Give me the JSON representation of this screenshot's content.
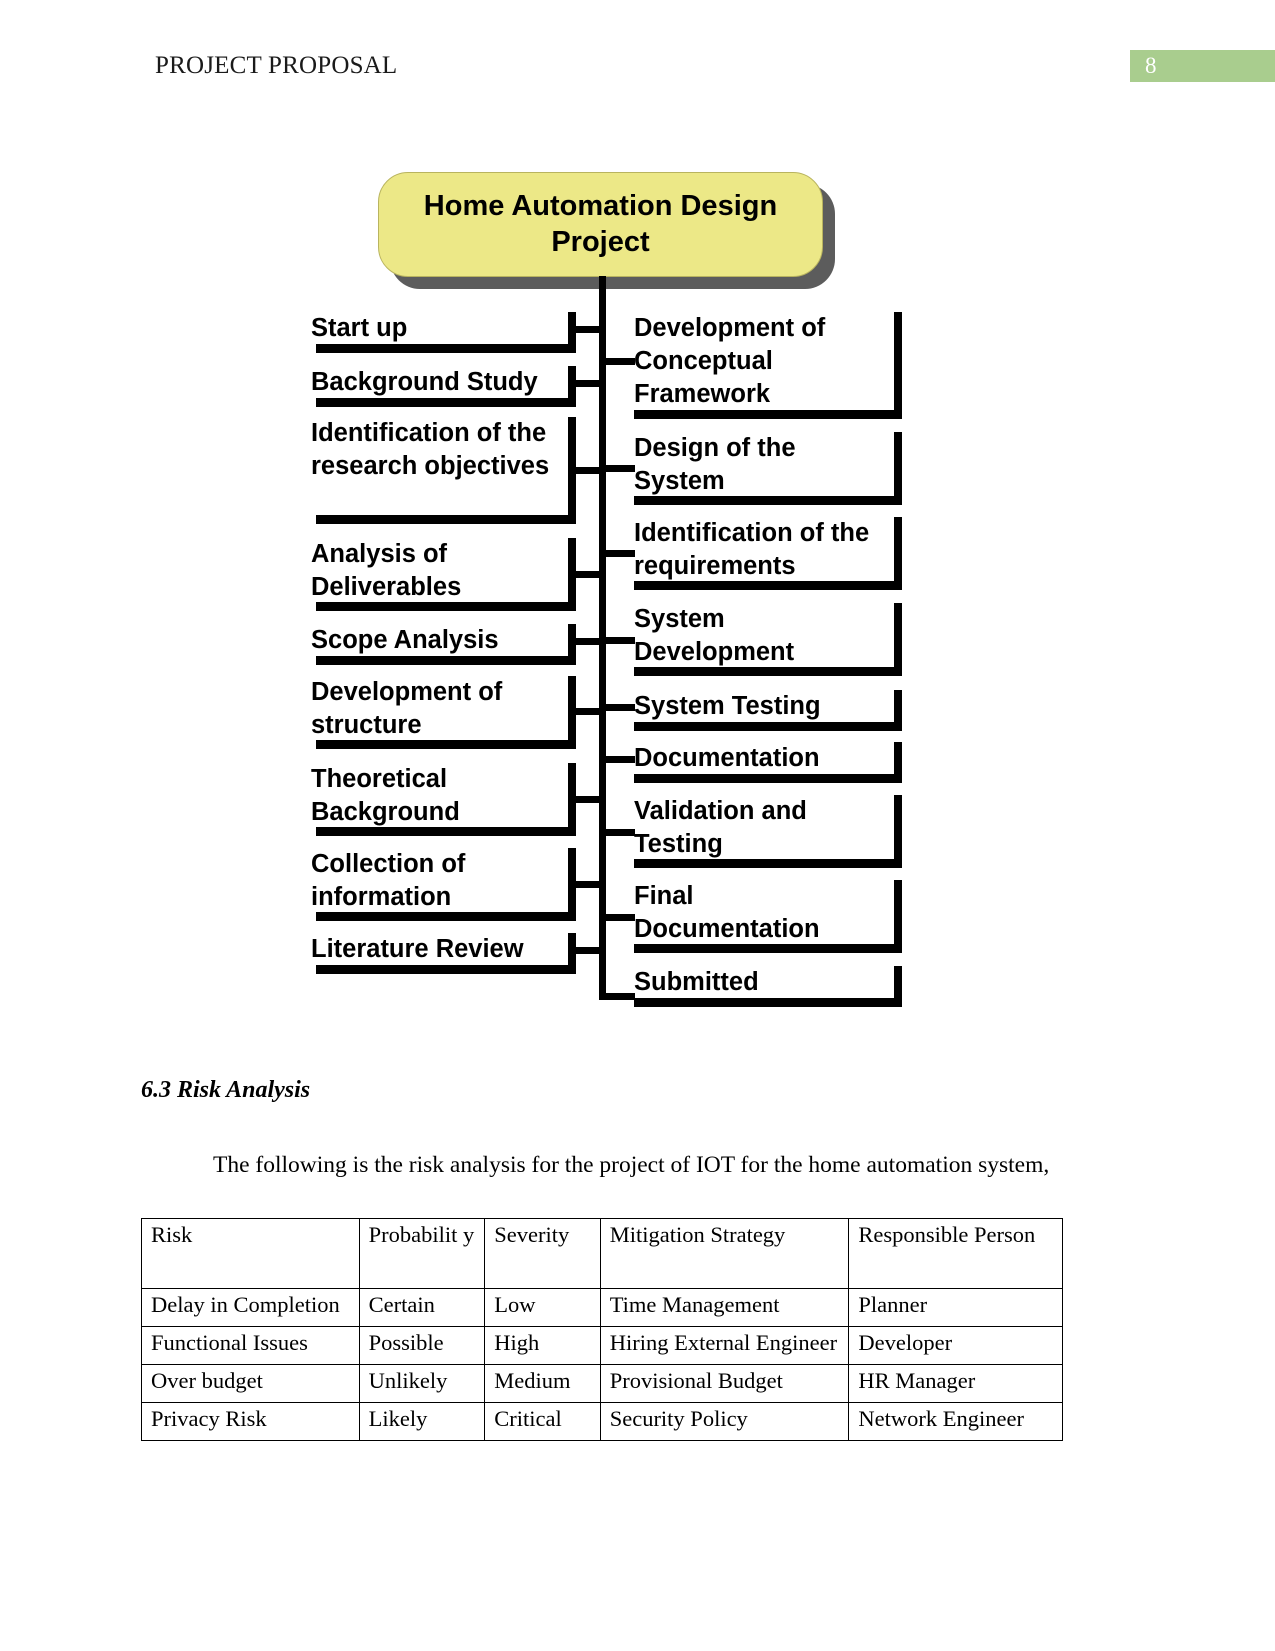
{
  "header": {
    "title": "PROJECT PROPOSAL",
    "page_number": "8",
    "badge_color": "#a9cd8e"
  },
  "flowchart": {
    "root": "Home Automation Design Project",
    "root_fill": "#ece887",
    "left_items": [
      "Start up",
      "Background Study",
      "Identification of the research objectives",
      "Analysis of Deliverables",
      "Scope Analysis",
      "Development of structure",
      "Theoretical Background",
      "Collection of information",
      "Literature Review"
    ],
    "right_items": [
      "Development of Conceptual Framework",
      "Design of the System",
      "Identification of the requirements",
      "System Development",
      "System Testing",
      "Documentation",
      "Validation and Testing",
      "Final Documentation",
      "Submitted"
    ]
  },
  "section": {
    "heading": "6.3 Risk Analysis",
    "paragraph": "The following is the risk analysis for the project of IOT for the home automation system,"
  },
  "table": {
    "headers": [
      "Risk",
      "Probabilit y",
      "Severity",
      "Mitigation Strategy",
      "Responsible Person"
    ],
    "rows": [
      {
        "risk": "Delay in Completion",
        "probability": "Certain",
        "severity": "Low",
        "mitigation": "Time Management",
        "responsible": "Planner"
      },
      {
        "risk": "Functional Issues",
        "probability": "Possible",
        "severity": "High",
        "mitigation": "Hiring External Engineer",
        "responsible": "Developer"
      },
      {
        "risk": "Over budget",
        "probability": "Unlikely",
        "severity": "Medium",
        "mitigation": "Provisional Budget",
        "responsible": "HR Manager"
      },
      {
        "risk": "Privacy Risk",
        "probability": "Likely",
        "severity": "Critical",
        "mitigation": "Security Policy",
        "responsible": "Network Engineer"
      }
    ]
  }
}
